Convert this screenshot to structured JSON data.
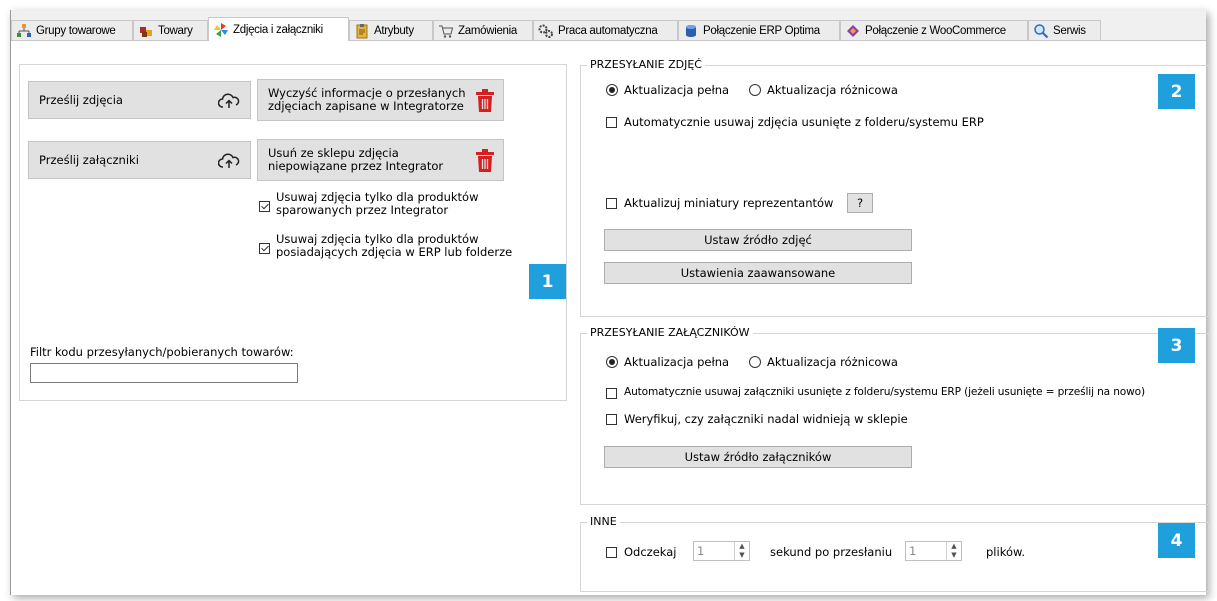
{
  "tabs": [
    {
      "label": "Grupy towarowe",
      "icon": "hierarchy-icon"
    },
    {
      "label": "Towary",
      "icon": "boxes-icon"
    },
    {
      "label": "Zdjęcia i załączniki",
      "icon": "pinwheel-icon"
    },
    {
      "label": "Atrybuty",
      "icon": "clipboard-icon"
    },
    {
      "label": "Zamówienia",
      "icon": "cart-icon"
    },
    {
      "label": "Praca automatyczna",
      "icon": "gears-icon"
    },
    {
      "label": "Połączenie ERP Optima",
      "icon": "database-icon"
    },
    {
      "label": "Połączenie z WooCommerce",
      "icon": "connection-icon"
    },
    {
      "label": "Serwis",
      "icon": "magnifier-icon"
    }
  ],
  "left": {
    "upload_images": "Prześlij zdjęcia",
    "upload_attachments": "Prześlij załączniki",
    "clear_info_line1": "Wyczyść informacje o przesłanych",
    "clear_info_line2": "zdjęciach zapisane w Integratorze",
    "remove_unlinked_line1": "Usuń ze sklepu zdjęcia",
    "remove_unlinked_line2": "niepowiązane przez Integrator",
    "cb_paired_line1": "Usuwaj zdjęcia tylko dla produktów",
    "cb_paired_line2": "sparowanych przez Integrator",
    "cb_has_images_line1": "Usuwaj zdjęcia tylko dla produktów",
    "cb_has_images_line2": "posiadających zdjęcia w ERP lub folderze",
    "filter_label": "Filtr kodu przesyłanych/pobieranych towarów:",
    "filter_value": ""
  },
  "images": {
    "title": "PRZESYŁANIE ZDJĘĆ",
    "radio_full": "Aktualizacja pełna",
    "radio_diff": "Aktualizacja różnicowa",
    "cb_auto_delete": "Automatycznie usuwaj zdjęcia usunięte z folderu/systemu ERP",
    "cb_thumbnails": "Aktualizuj miniatury reprezentantów",
    "help": "?",
    "set_source": "Ustaw źródło zdjęć",
    "advanced": "Ustawienia zaawansowane"
  },
  "attachments": {
    "title": "PRZESYŁANIE ZAŁĄCZNIKÓW",
    "radio_full": "Aktualizacja pełna",
    "radio_diff": "Aktualizacja różnicowa",
    "cb_auto_delete": "Automatycznie usuwaj załączniki usunięte z folderu/systemu ERP (jeżeli usunięte = prześlij na nowo)",
    "cb_verify": "Weryfikuj, czy załączniki nadal widnieją w sklepie",
    "set_source": "Ustaw źródło załączników"
  },
  "other": {
    "title": "INNE",
    "wait_label": "Odczekaj",
    "wait_value": "1",
    "seconds_label": "sekund po przesłaniu",
    "files_value": "1",
    "files_label": "plików."
  },
  "badges": [
    "1",
    "2",
    "3",
    "4"
  ],
  "colors": {
    "badge": "#1fa0dd",
    "trash": "#d42020"
  }
}
